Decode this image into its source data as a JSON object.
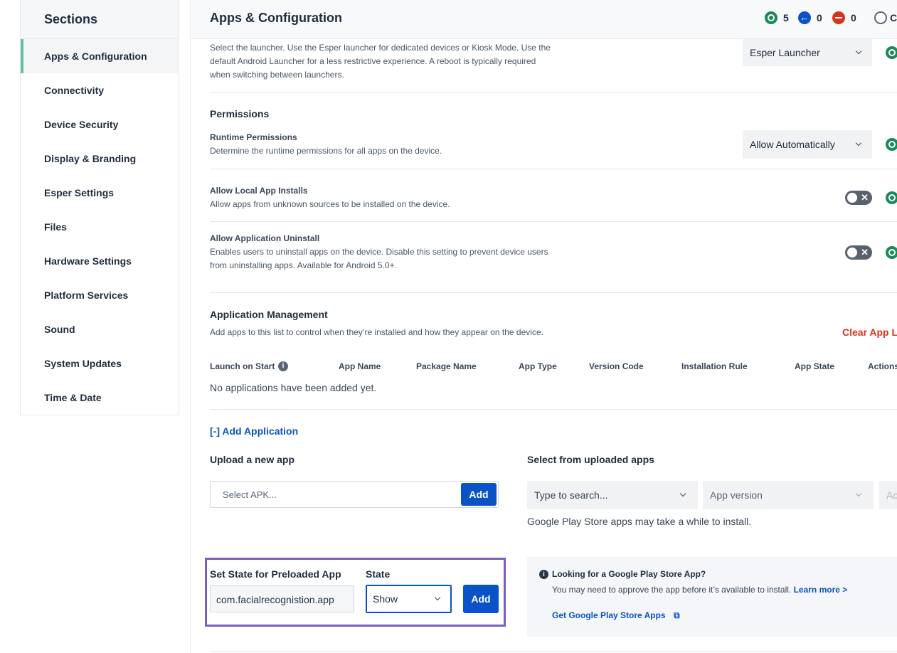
{
  "sidebar": {
    "title": "Sections",
    "items": [
      {
        "label": "Apps & Configuration"
      },
      {
        "label": "Connectivity"
      },
      {
        "label": "Device Security"
      },
      {
        "label": "Display & Branding"
      },
      {
        "label": "Esper Settings"
      },
      {
        "label": "Files"
      },
      {
        "label": "Hardware Settings"
      },
      {
        "label": "Platform Services"
      },
      {
        "label": "Sound"
      },
      {
        "label": "System Updates"
      },
      {
        "label": "Time & Date"
      }
    ]
  },
  "header": {
    "title": "Apps & Configuration",
    "stats": {
      "success": "5",
      "pending": "0",
      "failed": "0",
      "other_label": "C"
    }
  },
  "launcher": {
    "description_lines": [
      "Select the launcher. Use the Esper launcher for dedicated devices or Kiosk Mode. Use the",
      "default Android Launcher for a less restrictive experience. A reboot is typically required",
      "when switching between launchers."
    ],
    "value": "Esper Launcher"
  },
  "permissions": {
    "title": "Permissions",
    "runtime": {
      "label": "Runtime Permissions",
      "description": "Determine the runtime permissions for all apps on the device.",
      "value": "Allow Automatically"
    },
    "local_installs": {
      "label": "Allow Local App Installs",
      "description": "Allow apps from unknown sources to be installed on the device.",
      "enabled": false
    },
    "uninstall": {
      "label": "Allow Application Uninstall",
      "description_lines": [
        "Enables users to uninstall apps on the device. Disable this setting to prevent device users",
        "from uninstalling apps. Available for Android 5.0+."
      ],
      "enabled": false
    }
  },
  "app_management": {
    "title": "Application Management",
    "description": "Add apps to this list to control when they’re installed and how they appear on the device.",
    "clear_label": "Clear App Li",
    "columns": [
      "Launch on Start",
      "App Name",
      "Package Name",
      "App Type",
      "Version Code",
      "Installation Rule",
      "App State",
      "Actions"
    ],
    "empty_text": "No applications have been added yet."
  },
  "add_application": {
    "toggle_label": "[-] Add Application",
    "upload_title": "Upload a new app",
    "upload_placeholder": "Select APK...",
    "upload_add": "Add",
    "select_title": "Select from uploaded apps",
    "search_placeholder": "Type to search...",
    "version_placeholder": "App version",
    "add_partial": "Ac",
    "play_note": "Google Play Store apps may take a while to install."
  },
  "preloaded": {
    "title": "Set State for Preloaded App",
    "package_value": "com.facialrecognistion.app",
    "state_title": "State",
    "state_value": "Show",
    "add_label": "Add"
  },
  "play_info": {
    "title": "Looking for a Google Play Store App?",
    "body": "You may need to approve the app before it’s available to install.",
    "learn_more": "Learn more >",
    "link": "Get Google Play Store Apps"
  },
  "colors": {
    "accent": "#0a53c7",
    "success": "#1a8a5b",
    "danger": "#d8341b",
    "highlight": "#7a5fc0"
  }
}
